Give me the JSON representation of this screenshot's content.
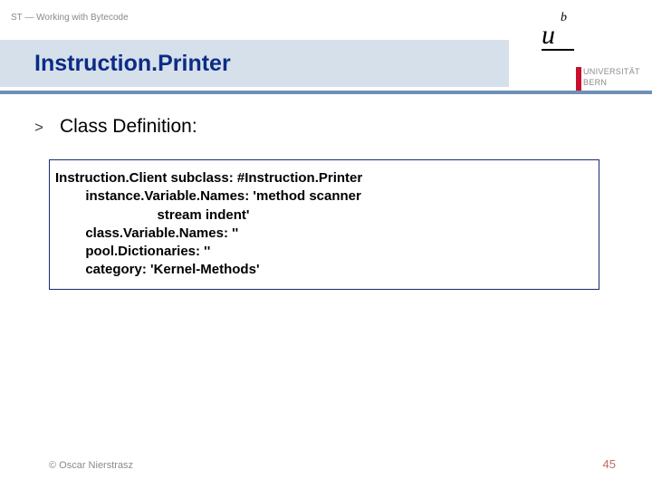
{
  "header": {
    "label": "ST — Working with Bytecode"
  },
  "title": "Instruction.Printer",
  "logo": {
    "u": "u",
    "b": "b",
    "uni_line1": "UNIVERSITÄT",
    "uni_line2": "BERN"
  },
  "bullet": {
    "marker": ">",
    "text": "Class Definition:"
  },
  "code": {
    "l1": "Instruction.Client subclass: #Instruction.Printer",
    "l2": "        instance.Variable.Names: 'method scanner",
    "l3": "                           stream indent'",
    "l4": "        class.Variable.Names: ''",
    "l5": "        pool.Dictionaries: ''",
    "l6": "        category: 'Kernel-Methods'"
  },
  "footer": {
    "left": "© Oscar Nierstrasz",
    "right": "45"
  }
}
